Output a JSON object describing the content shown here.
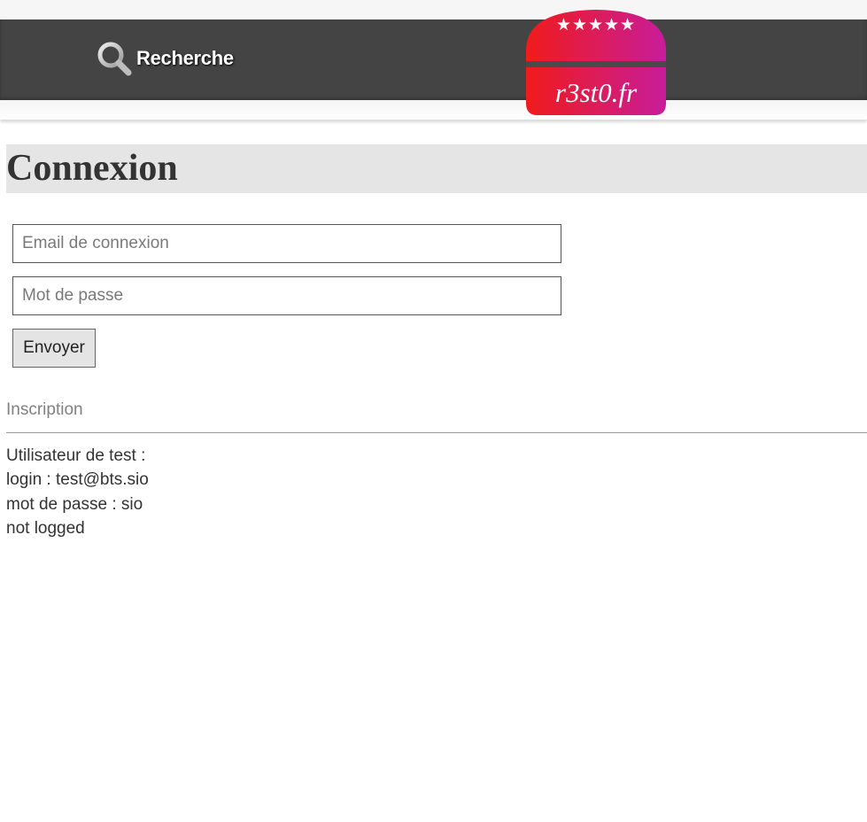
{
  "header": {
    "search_label": "Recherche",
    "search_icon": "search-icon",
    "logo_text": "r3st0.fr",
    "logo_stars": "★★★★★"
  },
  "main": {
    "title": "Connexion",
    "form": {
      "email_placeholder": "Email de connexion",
      "email_value": "",
      "password_placeholder": "Mot de passe",
      "password_value": "",
      "submit_label": "Envoyer"
    },
    "signup_link": "Inscription",
    "info_lines": [
      "Utilisateur de test :",
      "login : test@bts.sio",
      "mot de passe : sio",
      "not logged"
    ]
  },
  "colors": {
    "navbar": "#444444",
    "title_background": "#e5e5e5",
    "logo_gradient_start": "#f01b1b",
    "logo_gradient_end": "#c81c9a",
    "link_gray": "#808080"
  }
}
